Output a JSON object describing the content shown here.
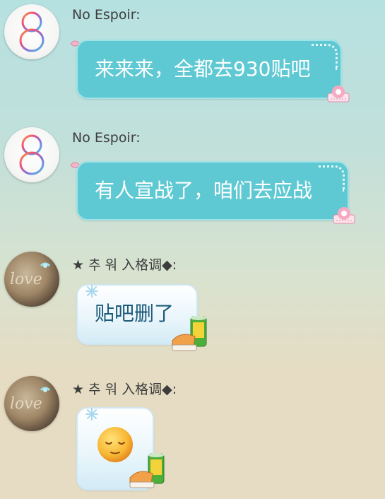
{
  "messages": [
    {
      "sender": "No Espoir:",
      "avatar": "digit-8-avatar",
      "text": "来来来，全都去930贴吧"
    },
    {
      "sender": "No Espoir:",
      "avatar": "digit-8-avatar",
      "text": "有人宣战了，咱们去应战"
    },
    {
      "sender": "★ 추 워 入格调◆:",
      "avatar": "love-avatar",
      "avatar_text": "love",
      "text": "贴吧删了"
    },
    {
      "sender": "★ 추 워 入格调◆:",
      "avatar": "love-avatar",
      "avatar_text": "love",
      "emoji": "relieved-face-emoji"
    }
  ],
  "colors": {
    "teal_bubble": "#5fc9d3",
    "light_bubble": "#eaf6fb",
    "sender_text": "#3d3d3d",
    "light_bubble_text": "#1c5a7a"
  }
}
